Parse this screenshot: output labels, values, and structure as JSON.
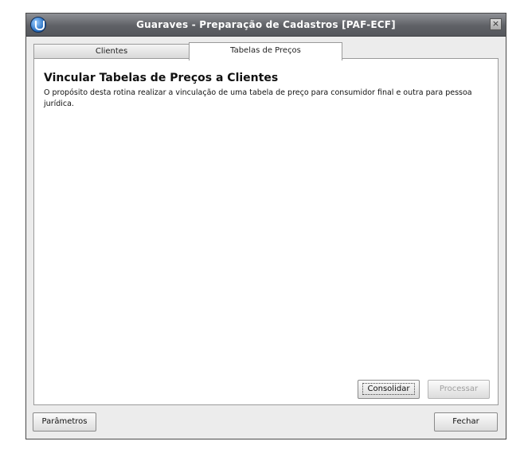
{
  "window": {
    "title": "Guaraves - Preparação de Cadastros [PAF-ECF]",
    "close_glyph": "×"
  },
  "tabs": [
    {
      "label": "Clientes",
      "active": false
    },
    {
      "label": "Tabelas de Preços",
      "active": true
    }
  ],
  "panel": {
    "title": "Vincular Tabelas de Preços a Clientes",
    "description": "O propósito desta rotina realizar a vinculação de uma tabela de preço para consumidor final e outra para pessoa jurídica."
  },
  "buttons": {
    "consolidar": "Consolidar",
    "processar": "Processar",
    "parametros": "Parâmetros",
    "fechar": "Fechar"
  },
  "icons": {
    "app": "app-logo-icon",
    "close": "close-icon"
  }
}
